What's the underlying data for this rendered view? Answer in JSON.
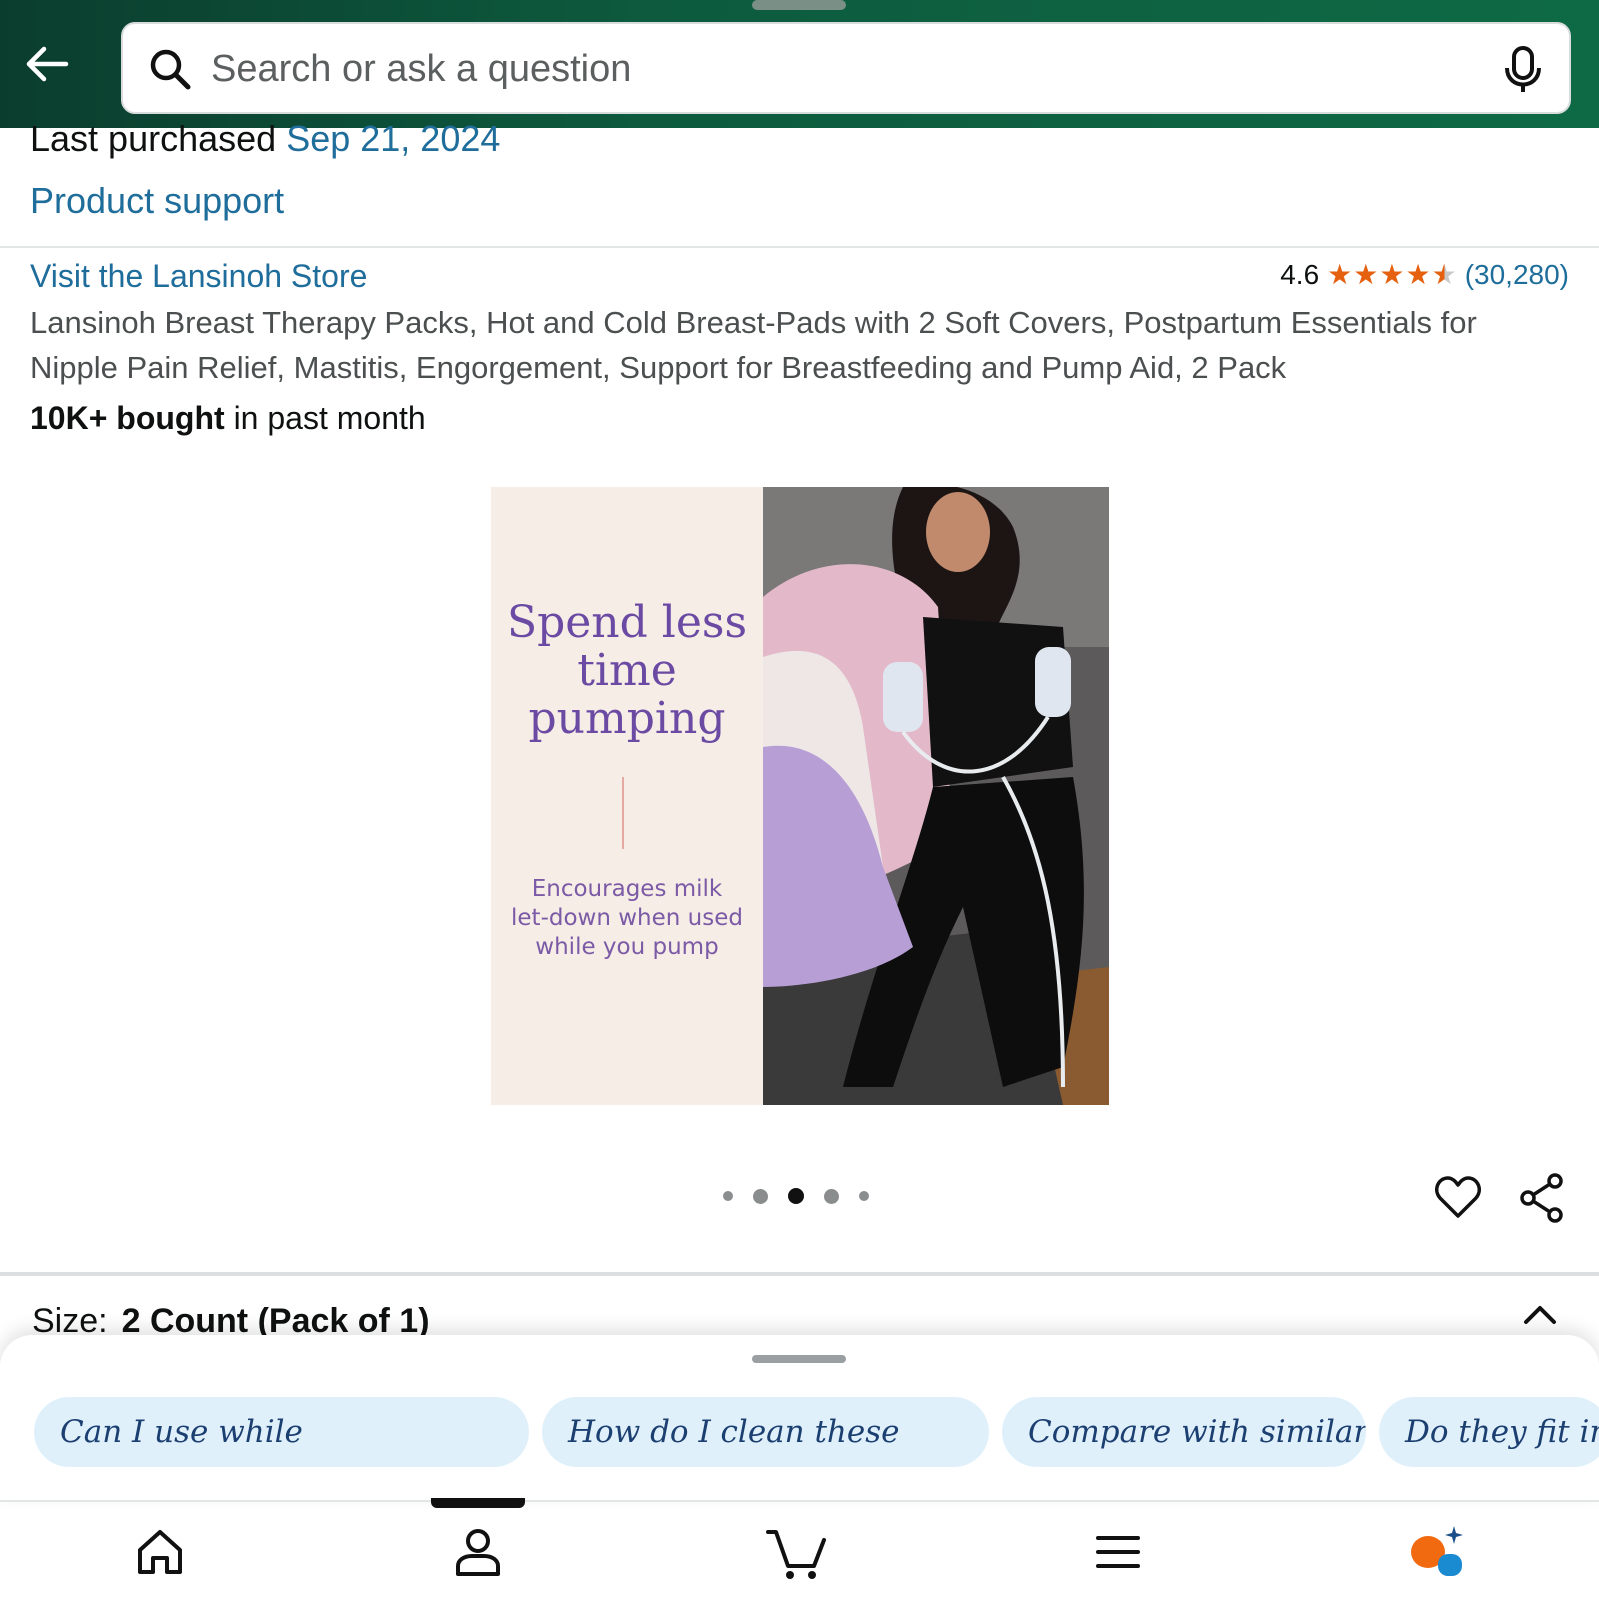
{
  "header": {
    "search_placeholder": "Search or ask a question"
  },
  "purchase": {
    "label": "Last purchased",
    "date": "Sep 21, 2024",
    "support_link": "Product support"
  },
  "product": {
    "store_link": "Visit the Lansinoh Store",
    "rating": "4.6",
    "rating_count": "(30,280)",
    "stars": 4.5,
    "title": "Lansinoh Breast Therapy Packs, Hot and Cold Breast-Pads with 2 Soft Covers, Postpartum Essentials for Nipple Pain Relief, Mastitis, Engorgement, Support for Breastfeeding and Pump Aid, 2 Pack",
    "bought_bold": "10K+ bought",
    "bought_rest": "in past month"
  },
  "image": {
    "headline": "Spend less time pumping",
    "subtext": "Encourages milk let-down when used while you pump",
    "dot_count": 5,
    "active_dot": 3
  },
  "size": {
    "label": "Size:",
    "value": "2 Count (Pack of 1)"
  },
  "suggestions": [
    "Can I use while",
    "How do I clean these",
    "Compare with similar",
    "Do they fit in"
  ],
  "colors": {
    "header": "#0d5a3e",
    "link": "#1f6d9b",
    "star": "#e6610f",
    "chip_bg": "#e0f0fb"
  },
  "nav": [
    "home-icon",
    "account-icon",
    "cart-icon",
    "menu-icon",
    "rufus-icon"
  ]
}
